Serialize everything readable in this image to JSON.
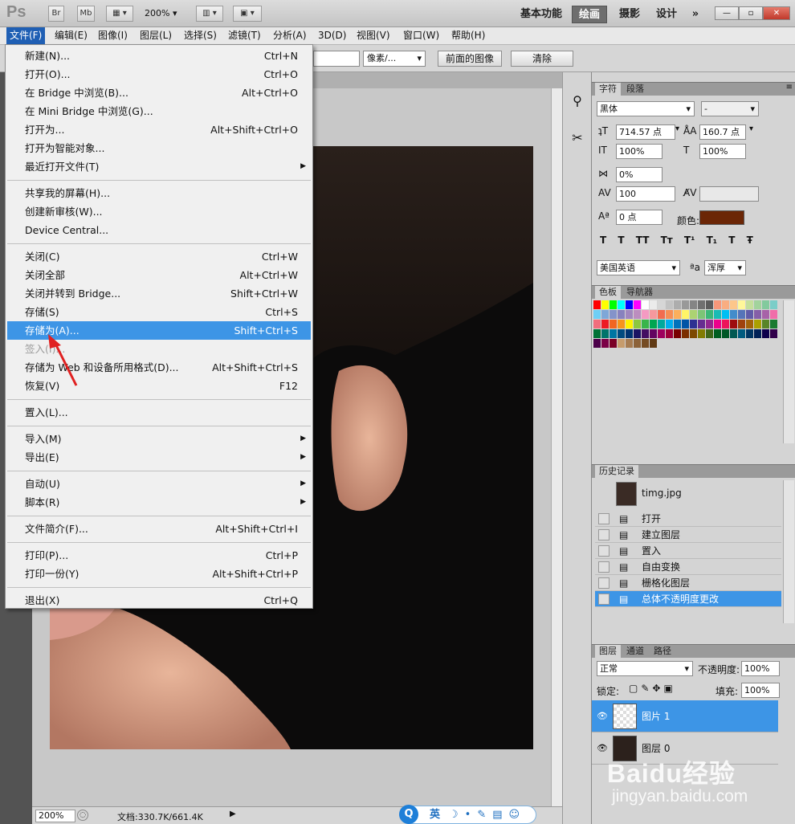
{
  "app": {
    "logo": "Ps",
    "toolbar": {
      "br": "Br",
      "mb": "Mb",
      "zoom": "200%"
    },
    "workspaces": [
      "基本功能",
      "绘画",
      "摄影",
      "设计"
    ],
    "active_workspace": "绘画",
    "overflow": "»",
    "window_controls": {
      "minimize": "—",
      "restore": "▫",
      "close": "✕"
    }
  },
  "menubar": [
    "文件(F)",
    "编辑(E)",
    "图像(I)",
    "图层(L)",
    "选择(S)",
    "滤镜(T)",
    "分析(A)",
    "3D(D)",
    "视图(V)",
    "窗口(W)",
    "帮助(H)"
  ],
  "options": {
    "unit": "像素/...",
    "front_image": "前面的图像",
    "clear": "清除"
  },
  "file_menu": {
    "groups": [
      [
        {
          "label": "新建(N)...",
          "shortcut": "Ctrl+N"
        },
        {
          "label": "打开(O)...",
          "shortcut": "Ctrl+O"
        },
        {
          "label": "在 Bridge 中浏览(B)...",
          "shortcut": "Alt+Ctrl+O"
        },
        {
          "label": "在 Mini Bridge 中浏览(G)...",
          "shortcut": ""
        },
        {
          "label": "打开为...",
          "shortcut": "Alt+Shift+Ctrl+O"
        },
        {
          "label": "打开为智能对象...",
          "shortcut": ""
        },
        {
          "label": "最近打开文件(T)",
          "shortcut": "",
          "submenu": true
        }
      ],
      [
        {
          "label": "共享我的屏幕(H)...",
          "shortcut": ""
        },
        {
          "label": "创建新审核(W)...",
          "shortcut": ""
        },
        {
          "label": "Device Central...",
          "shortcut": ""
        }
      ],
      [
        {
          "label": "关闭(C)",
          "shortcut": "Ctrl+W"
        },
        {
          "label": "关闭全部",
          "shortcut": "Alt+Ctrl+W"
        },
        {
          "label": "关闭并转到 Bridge...",
          "shortcut": "Shift+Ctrl+W"
        },
        {
          "label": "存储(S)",
          "shortcut": "Ctrl+S"
        },
        {
          "label": "存储为(A)...",
          "shortcut": "Shift+Ctrl+S",
          "highlighted": true
        },
        {
          "label": "签入(I)...",
          "shortcut": "",
          "disabled": true
        },
        {
          "label": "存储为 Web 和设备所用格式(D)...",
          "shortcut": "Alt+Shift+Ctrl+S"
        },
        {
          "label": "恢复(V)",
          "shortcut": "F12"
        }
      ],
      [
        {
          "label": "置入(L)...",
          "shortcut": ""
        }
      ],
      [
        {
          "label": "导入(M)",
          "shortcut": "",
          "submenu": true
        },
        {
          "label": "导出(E)",
          "shortcut": "",
          "submenu": true
        }
      ],
      [
        {
          "label": "自动(U)",
          "shortcut": "",
          "submenu": true
        },
        {
          "label": "脚本(R)",
          "shortcut": "",
          "submenu": true
        }
      ],
      [
        {
          "label": "文件简介(F)...",
          "shortcut": "Alt+Shift+Ctrl+I"
        }
      ],
      [
        {
          "label": "打印(P)...",
          "shortcut": "Ctrl+P"
        },
        {
          "label": "打印一份(Y)",
          "shortcut": "Alt+Shift+Ctrl+P"
        }
      ],
      [
        {
          "label": "退出(X)",
          "shortcut": "Ctrl+Q"
        }
      ]
    ]
  },
  "character_panel": {
    "tabs": [
      "字符",
      "段落"
    ],
    "font": "黑体",
    "style": "-",
    "size": "714.57 点",
    "leading": "160.7 点",
    "vscale": "100%",
    "hscale": "100%",
    "tsume": "0%",
    "tracking": "100",
    "baseline": "0 点",
    "color_label": "颜色:",
    "color": "#6b2606",
    "language": "美国英语",
    "antialias": "浑厚",
    "style_buttons": [
      "T",
      "T",
      "TT",
      "Tт",
      "T¹",
      "T₁",
      "T",
      "Ŧ"
    ]
  },
  "swatches_panel": {
    "tabs": [
      "色板",
      "导航器"
    ]
  },
  "history_panel": {
    "tab": "历史记录",
    "snapshot": "timg.jpg",
    "states": [
      "打开",
      "建立图层",
      "置入",
      "自由变换",
      "栅格化图层",
      "总体不透明度更改"
    ],
    "selected": "总体不透明度更改"
  },
  "layers_panel": {
    "tabs": [
      "图层",
      "通道",
      "路径"
    ],
    "blend": "正常",
    "opacity_label": "不透明度:",
    "opacity": "100%",
    "lock_label": "锁定:",
    "fill_label": "填充:",
    "fill": "100%",
    "layers": [
      {
        "name": "图片 1",
        "selected": true
      },
      {
        "name": "图层 0",
        "selected": false
      }
    ]
  },
  "status": {
    "zoom": "200%",
    "doc": "文档:330.7K/661.4K"
  },
  "ime": {
    "lang": "英"
  },
  "watermark": {
    "brand": "Baidu经验",
    "url": "jingyan.baidu.com"
  }
}
